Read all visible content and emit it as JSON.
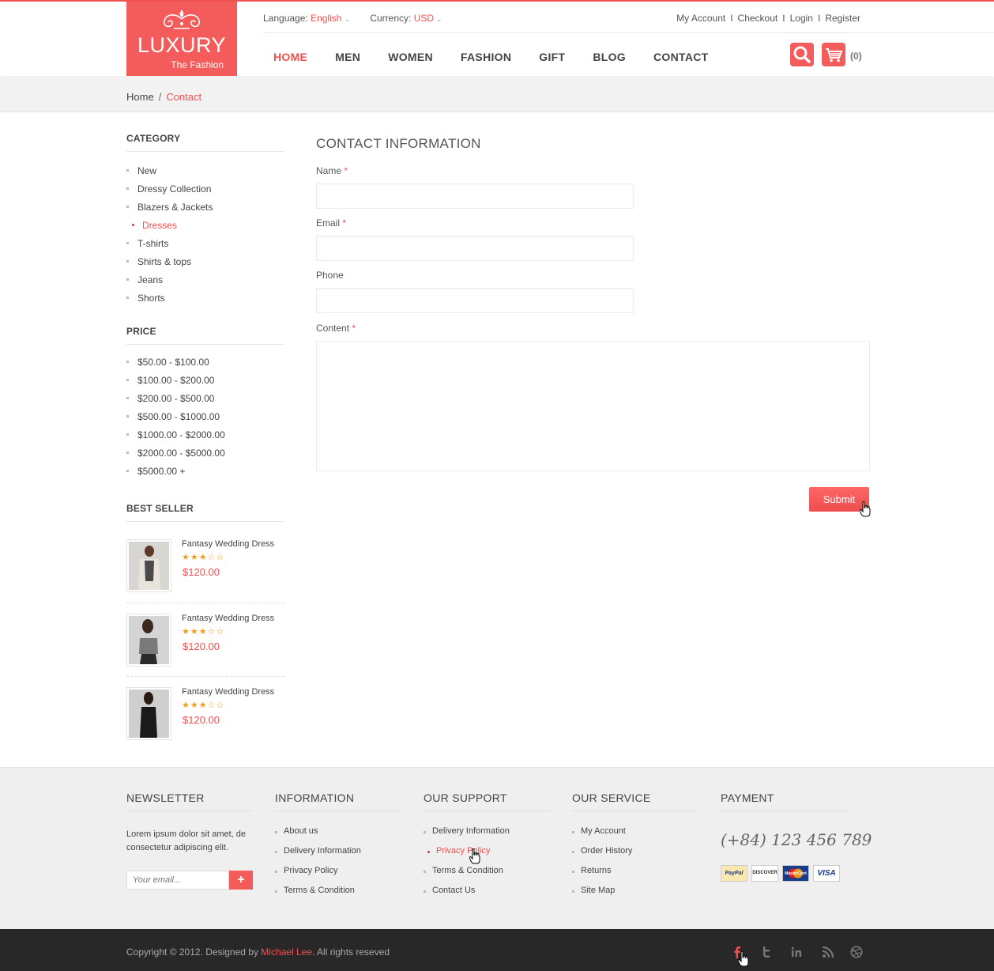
{
  "header": {
    "logo_brand": "LUXURY",
    "logo_tagline": "The Fashion",
    "language_label": "Language:",
    "language_value": "English",
    "currency_label": "Currency:",
    "currency_value": "USD",
    "links": [
      "My Account",
      "Checkout",
      "Login",
      "Register"
    ],
    "link_sep": "I",
    "nav": [
      "HOME",
      "MEN",
      "WOMEN",
      "FASHION",
      "GIFT",
      "BLOG",
      "CONTACT"
    ],
    "active_nav": "HOME",
    "cart_count": "(0)"
  },
  "breadcrumb": {
    "home": "Home",
    "sep": "/",
    "current": "Contact"
  },
  "sidebar": {
    "category_heading": "CATEGORY",
    "categories": [
      "New",
      "Dressy Collection",
      "Blazers & Jackets",
      "Dresses",
      "T-shirts",
      "Shirts & tops",
      "Jeans",
      "Shorts"
    ],
    "active_category": "Dresses",
    "price_heading": "PRICE",
    "prices": [
      "$50.00 - $100.00",
      "$100.00 - $200.00",
      "$200.00 - $500.00",
      "$500.00 - $1000.00",
      "$1000.00 - $2000.00",
      "$2000.00 - $5000.00",
      "$5000.00 +"
    ],
    "bestseller_heading": "BEST SELLER",
    "bestsellers": [
      {
        "title": "Fantasy Wedding Dress",
        "rating": 3,
        "price": "$120.00"
      },
      {
        "title": "Fantasy Wedding Dress",
        "rating": 3,
        "price": "$120.00"
      },
      {
        "title": "Fantasy Wedding Dress",
        "rating": 3,
        "price": "$120.00"
      }
    ]
  },
  "form": {
    "heading": "CONTACT INFORMATION",
    "name_label": "Name",
    "email_label": "Email",
    "phone_label": "Phone",
    "content_label": "Content",
    "required_mark": "*",
    "name_value": "",
    "email_value": "",
    "phone_value": "",
    "content_value": "",
    "submit_label": "Submit"
  },
  "footer": {
    "newsletter_heading": "NEWSLETTER",
    "newsletter_text": "Lorem ipsum dolor sit amet, de consectetur adipiscing elit.",
    "newsletter_placeholder": "Your email...",
    "newsletter_button": "+",
    "information_heading": "INFORMATION",
    "information": [
      "About us",
      "Delivery Information",
      "Privacy Policy",
      "Terms & Condition"
    ],
    "support_heading": "OUR SUPPORT",
    "support": [
      "Delivery Information",
      "Privacy Policy",
      "Terms & Condition",
      "Contact Us"
    ],
    "support_active": "Privacy Policy",
    "service_heading": "OUR SERVICE",
    "service": [
      "My Account",
      "Order History",
      "Returns",
      "Site Map"
    ],
    "payment_heading": "PAYMENT",
    "phone": "(+84) 123 456 789",
    "payment_cards": [
      "PayPal",
      "DISCOVER",
      "MasterCard",
      "VISA"
    ]
  },
  "bottom": {
    "copyright_prefix": "Copyright © 2012. Designed by",
    "designer": "Michael Lee",
    "copyright_suffix": ". All rights reseved",
    "social_icons": [
      "facebook-icon",
      "twitter-icon",
      "linkedin-icon",
      "rss-icon",
      "dribbble-icon"
    ]
  },
  "colors": {
    "accent": "#f45b5b",
    "text": "#444444",
    "footer_bg": "#efefef",
    "bottom_bg": "#282828"
  }
}
